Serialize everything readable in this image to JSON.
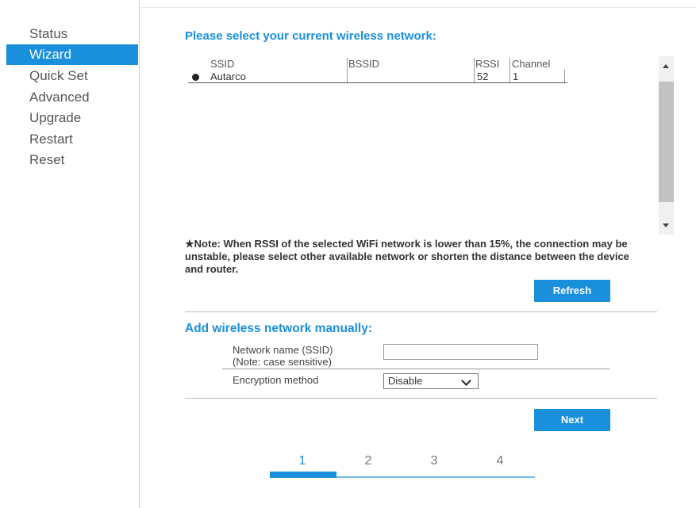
{
  "sidebar": {
    "items": [
      {
        "label": "Status"
      },
      {
        "label": "Wizard",
        "active": true
      },
      {
        "label": "Quick Set"
      },
      {
        "label": "Advanced"
      },
      {
        "label": "Upgrade"
      },
      {
        "label": "Restart"
      },
      {
        "label": "Reset"
      }
    ]
  },
  "wizard": {
    "title": "Please select your current wireless network:",
    "table": {
      "headers": [
        "SSID",
        "BSSID",
        "RSSI",
        "Channel"
      ],
      "rows": [
        {
          "ssid": "Autarco",
          "bssid": "",
          "rssi": "52",
          "channel": "1",
          "selected": true
        }
      ]
    },
    "note": "★Note: When RSSI of the selected WiFi network is lower than 15%, the connection may be unstable, please select other available network or shorten the distance between the device and router.",
    "refresh_label": "Refresh",
    "manual_title": "Add wireless network manually:",
    "ssid_label_1": "Network name (SSID)",
    "ssid_label_2": "(Note: case sensitive)",
    "ssid_value": "",
    "encryption_label": "Encryption method",
    "encryption_value": "Disable",
    "next_label": "Next",
    "steps": [
      "1",
      "2",
      "3",
      "4"
    ],
    "current_step": 1
  },
  "colors": {
    "accent": "#1a8fdc"
  }
}
